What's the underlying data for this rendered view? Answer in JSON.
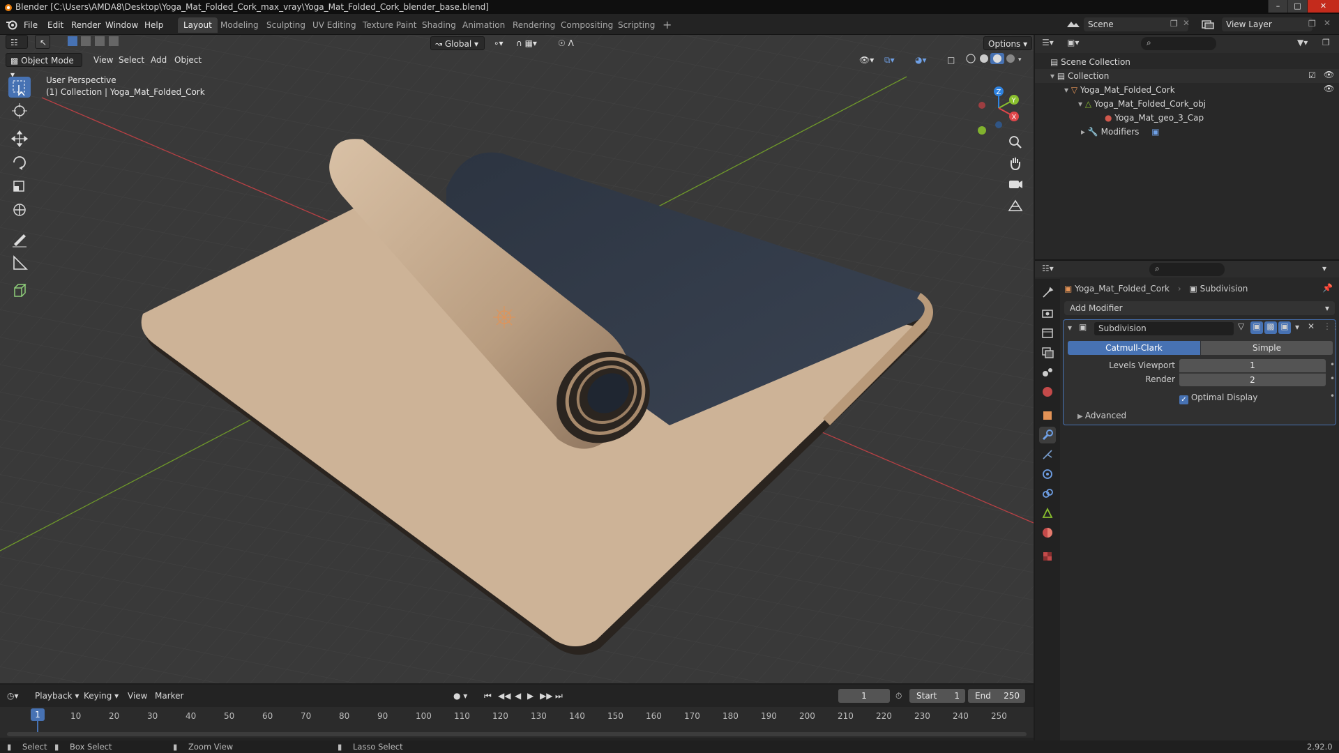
{
  "title_bar": {
    "title": "Blender [C:\\Users\\AMDA8\\Desktop\\Yoga_Mat_Folded_Cork_max_vray\\Yoga_Mat_Folded_Cork_blender_base.blend]"
  },
  "menu": {
    "file": "File",
    "edit": "Edit",
    "render": "Render",
    "window": "Window",
    "help": "Help"
  },
  "workspaces": [
    "Layout",
    "Modeling",
    "Sculpting",
    "UV Editing",
    "Texture Paint",
    "Shading",
    "Animation",
    "Rendering",
    "Compositing",
    "Scripting"
  ],
  "scene": {
    "name": "Scene",
    "view_layer": "View Layer"
  },
  "viewport": {
    "mode": "Object Mode",
    "menu": [
      "View",
      "Select",
      "Add",
      "Object"
    ],
    "transform_orientation": "Global",
    "options": "Options",
    "perspective": "User Perspective",
    "collection_info": "(1) Collection | Yoga_Mat_Folded_Cork",
    "gizmo": {
      "x": "X",
      "y": "Y",
      "z": "Z"
    }
  },
  "outliner": {
    "scene_collection": "Scene Collection",
    "collection": "Collection",
    "object": "Yoga_Mat_Folded_Cork",
    "mesh": "Yoga_Mat_Folded_Cork_obj",
    "material": "Yoga_Mat_geo_3_Cap",
    "modifiers": "Modifiers"
  },
  "properties": {
    "object_name": "Yoga_Mat_Folded_Cork",
    "modifier_breadcrumb": "Subdivision",
    "add_modifier": "Add Modifier",
    "modifier": {
      "name": "Subdivision",
      "type_active": "Catmull-Clark",
      "type_other": "Simple",
      "levels_viewport_label": "Levels Viewport",
      "levels_viewport": "1",
      "render_label": "Render",
      "render": "2",
      "optimal_display": "Optimal Display",
      "advanced": "Advanced"
    }
  },
  "timeline": {
    "playback": "Playback",
    "keying": "Keying",
    "view": "View",
    "marker": "Marker",
    "current_frame": "1",
    "start_label": "Start",
    "start": "1",
    "end_label": "End",
    "end": "250",
    "ticks": [
      "10",
      "20",
      "30",
      "40",
      "50",
      "60",
      "70",
      "80",
      "90",
      "100",
      "110",
      "120",
      "130",
      "140",
      "150",
      "160",
      "170",
      "180",
      "190",
      "200",
      "210",
      "220",
      "230",
      "240",
      "250"
    ],
    "cursor_frame": "1"
  },
  "statusbar": {
    "select": "Select",
    "box_select": "Box Select",
    "zoom_view": "Zoom View",
    "lasso_select": "Lasso Select",
    "version": "2.92.0"
  },
  "colors": {
    "accent": "#4772b3",
    "viewport_bg": "#393939",
    "panel_bg": "#282828",
    "cork": "#cdb397",
    "mat_dark": "#2e3542",
    "x_axis": "#e0464a",
    "y_axis": "#8ac02e",
    "z_axis": "#2f83e1"
  }
}
